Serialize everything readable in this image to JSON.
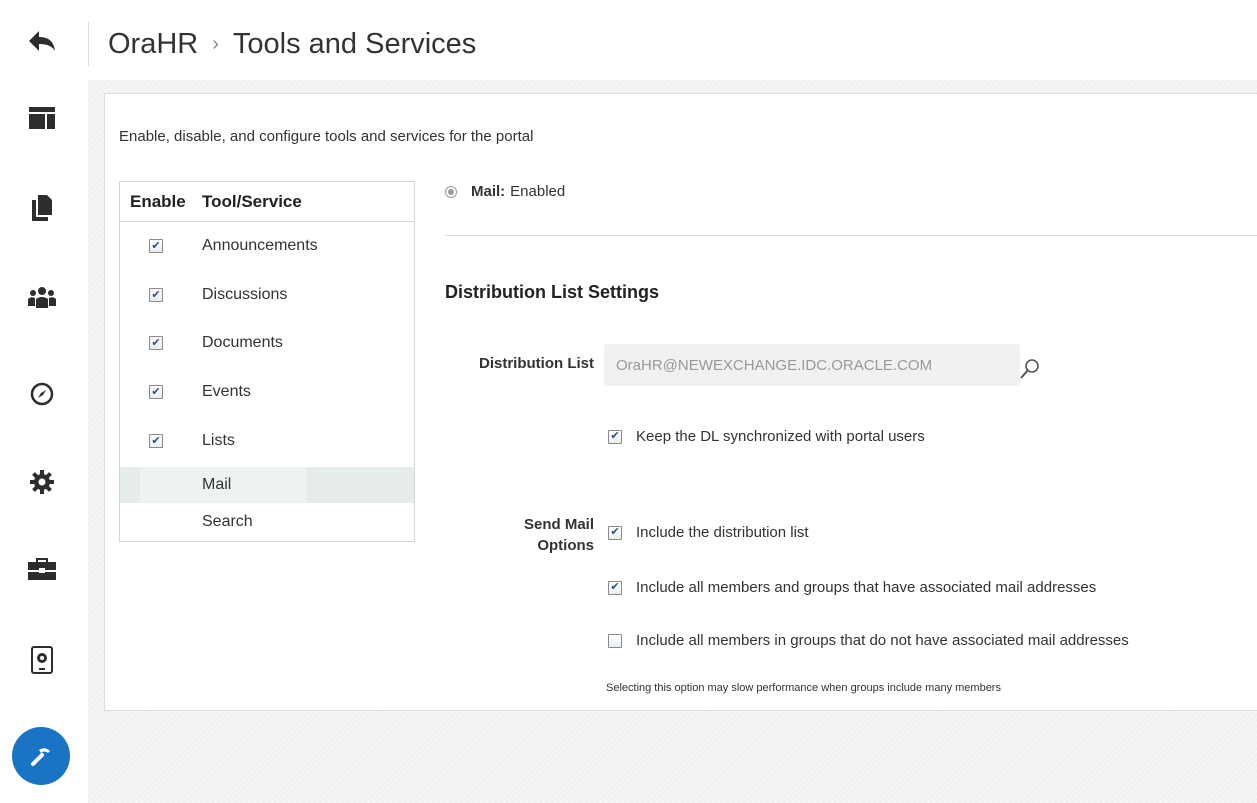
{
  "header": {
    "back_icon": "back-arrow-icon",
    "portal": "OraHR",
    "separator": "›",
    "page": "Tools and Services"
  },
  "rail": {
    "items": [
      {
        "name": "layout-icon"
      },
      {
        "name": "pages-icon"
      },
      {
        "name": "members-icon"
      },
      {
        "name": "navigation-icon"
      },
      {
        "name": "settings-icon"
      },
      {
        "name": "toolbox-icon"
      },
      {
        "name": "device-settings-icon"
      },
      {
        "name": "build-icon",
        "active": true
      }
    ],
    "active_color": "#1a73c4"
  },
  "intro": "Enable, disable, and configure tools and services for the portal",
  "tools_table": {
    "headers": {
      "enable": "Enable",
      "tool": "Tool/Service"
    },
    "rows": [
      {
        "label": "Announcements",
        "enabled": true,
        "has_checkbox": true
      },
      {
        "label": "Discussions",
        "enabled": true,
        "has_checkbox": true
      },
      {
        "label": "Documents",
        "enabled": true,
        "has_checkbox": true
      },
      {
        "label": "Events",
        "enabled": true,
        "has_checkbox": true
      },
      {
        "label": "Lists",
        "enabled": true,
        "has_checkbox": true
      },
      {
        "label": "Mail",
        "enabled": true,
        "has_checkbox": false,
        "selected": true
      },
      {
        "label": "Search",
        "enabled": true,
        "has_checkbox": false
      }
    ]
  },
  "detail": {
    "service_name": "Mail:",
    "service_status": "Enabled",
    "section_title": "Distribution List Settings",
    "dl_label": "Distribution List",
    "dl_value": "OraHR@NEWEXCHANGE.IDC.ORACLE.COM",
    "keep_sync_label": "Keep the DL synchronized with portal users",
    "keep_sync_checked": true,
    "send_mail_label_line1": "Send Mail",
    "send_mail_label_line2": "Options",
    "options": [
      {
        "label": "Include the distribution list",
        "checked": true
      },
      {
        "label": "Include all members and groups that have associated mail addresses",
        "checked": true
      },
      {
        "label": "Include all members in groups that do not have associated mail addresses",
        "checked": false
      }
    ],
    "note": "Selecting this option may slow performance when groups include many members"
  }
}
